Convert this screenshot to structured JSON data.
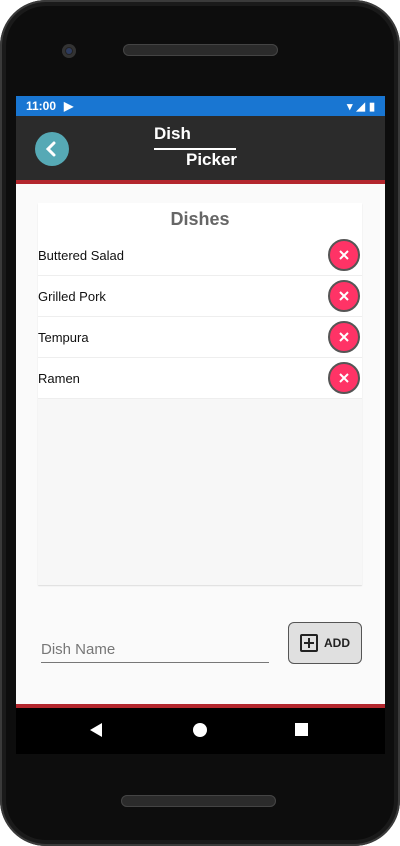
{
  "status": {
    "time": "11:00",
    "icons": [
      "wifi-icon",
      "signal-icon",
      "battery-icon"
    ]
  },
  "toolbar": {
    "title_top": "Dish",
    "title_bottom": "Picker"
  },
  "card": {
    "header": "Dishes"
  },
  "dishes": [
    {
      "name": "Buttered Salad"
    },
    {
      "name": "Grilled Pork"
    },
    {
      "name": "Tempura"
    },
    {
      "name": "Ramen"
    }
  ],
  "input": {
    "placeholder": "Dish Name"
  },
  "add": {
    "label": "ADD"
  },
  "colors": {
    "accent": "#b3262d",
    "back": "#56a9b5",
    "remove": "#ff3366",
    "status": "#1976d2"
  }
}
